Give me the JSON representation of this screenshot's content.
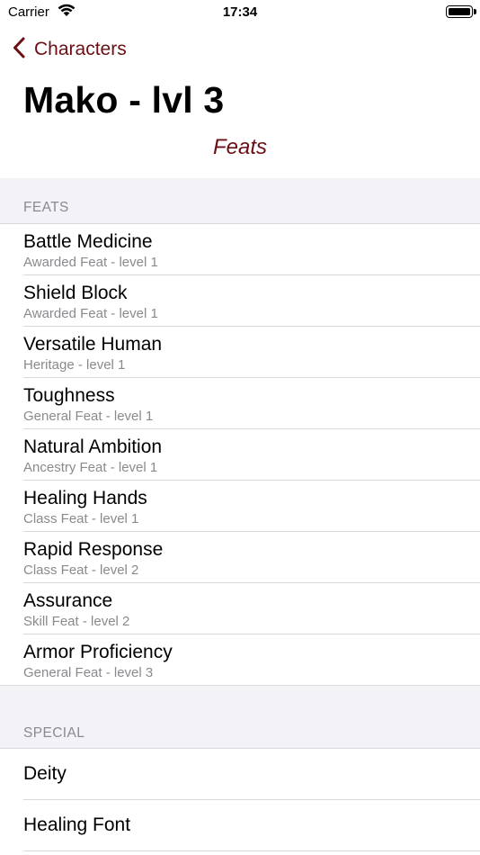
{
  "status_bar": {
    "carrier": "Carrier",
    "time": "17:34",
    "icons": [
      "wifi-icon",
      "battery-icon"
    ]
  },
  "nav": {
    "back_label": "Characters",
    "back_icon": "chevron-left-icon",
    "tint": "#6b0f14"
  },
  "header": {
    "title": "Mako - lvl 3",
    "subtitle": "Feats"
  },
  "feats_section": {
    "header": "FEATS",
    "items": [
      {
        "name": "Battle Medicine",
        "detail": "Awarded Feat - level 1"
      },
      {
        "name": "Shield Block",
        "detail": "Awarded Feat - level 1"
      },
      {
        "name": "Versatile Human",
        "detail": "Heritage - level 1"
      },
      {
        "name": "Toughness",
        "detail": "General Feat - level 1"
      },
      {
        "name": "Natural Ambition",
        "detail": "Ancestry Feat - level 1"
      },
      {
        "name": "Healing Hands",
        "detail": "Class Feat - level 1"
      },
      {
        "name": "Rapid Response",
        "detail": "Class Feat - level 2"
      },
      {
        "name": "Assurance",
        "detail": "Skill Feat - level 2"
      },
      {
        "name": "Armor Proficiency",
        "detail": "General Feat - level 3"
      }
    ]
  },
  "special_section": {
    "header": "SPECIAL",
    "items": [
      {
        "name": "Deity"
      },
      {
        "name": "Healing Font"
      }
    ]
  }
}
